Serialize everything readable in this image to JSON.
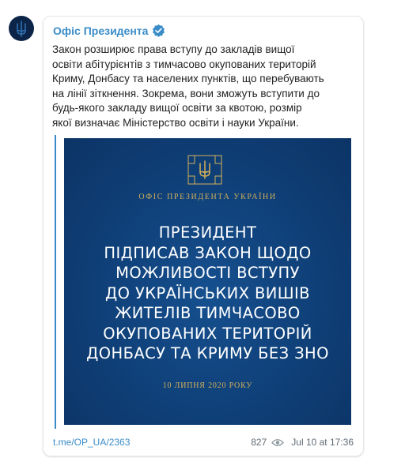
{
  "post": {
    "channel_name": "Офіс Президента",
    "text": "Закон розширює права вступу до закладів вищої\nосвіти абітурієнтів з тимчасово окупованих територій\nКриму, Донбасу та населених пунктів, що перебувають\nна лінії зіткнення. Зокрема, вони зможуть вступити до\nбудь-якого закладу вищої освіти за квотою, розмір\nякої визначає Міністерство освіти і науки України.",
    "source_link": "t.me/OP_UA/2363",
    "views": "827",
    "timestamp": "Jul 10 at 17:36"
  },
  "banner": {
    "office_label": "ОФІС ПРЕЗИДЕНТА УКРАЇНИ",
    "headline": "ПРЕЗИДЕНТ\nПІДПИСАВ ЗАКОН ЩОДО\nМОЖЛИВОСТІ ВСТУПУ\nДО УКРАЇНСЬКИХ ВИШІВ\nЖИТЕЛІВ ТИМЧАСОВО\nОКУПОВАНИХ ТЕРИТОРІЙ\nДОНБАСУ ТА КРИМУ БЕЗ ЗНО",
    "date": "10 ЛИПНЯ 2020 РОКУ"
  },
  "icons": {
    "avatar": "trident-emblem-icon",
    "verified": "verified-badge-icon",
    "emblem": "trident-emblem-icon",
    "views": "eye-icon"
  },
  "colors": {
    "accent": "#3a8cc8",
    "banner_blue": "#0f3f77",
    "gold": "#d2b05a"
  }
}
